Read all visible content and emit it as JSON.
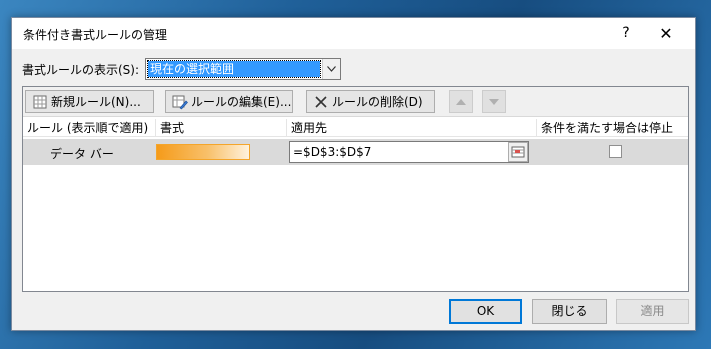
{
  "dialog": {
    "title": "条件付き書式ルールの管理",
    "help_glyph": "?",
    "close_glyph": "✕"
  },
  "display": {
    "label": "書式ルールの表示(S):",
    "selected": "現在の選択範囲"
  },
  "toolbar": {
    "new_rule": "新規ルール(N)...",
    "edit_rule": "ルールの編集(E)...",
    "delete_rule": "ルールの削除(D)"
  },
  "table": {
    "headers": {
      "rule": "ルール (表示順で適用)",
      "format": "書式",
      "applies_to": "適用先",
      "stop_if_true": "条件を満たす場合は停止"
    },
    "rows": [
      {
        "rule": "データ バー",
        "applies_to": "=$D$3:$D$7",
        "stop_if_true": false
      }
    ]
  },
  "footer": {
    "ok": "OK",
    "close": "閉じる",
    "apply": "適用"
  },
  "colors": {
    "databar_start": "#f59b1a",
    "databar_end": "#fff2dc",
    "selection": "#3399ff"
  }
}
